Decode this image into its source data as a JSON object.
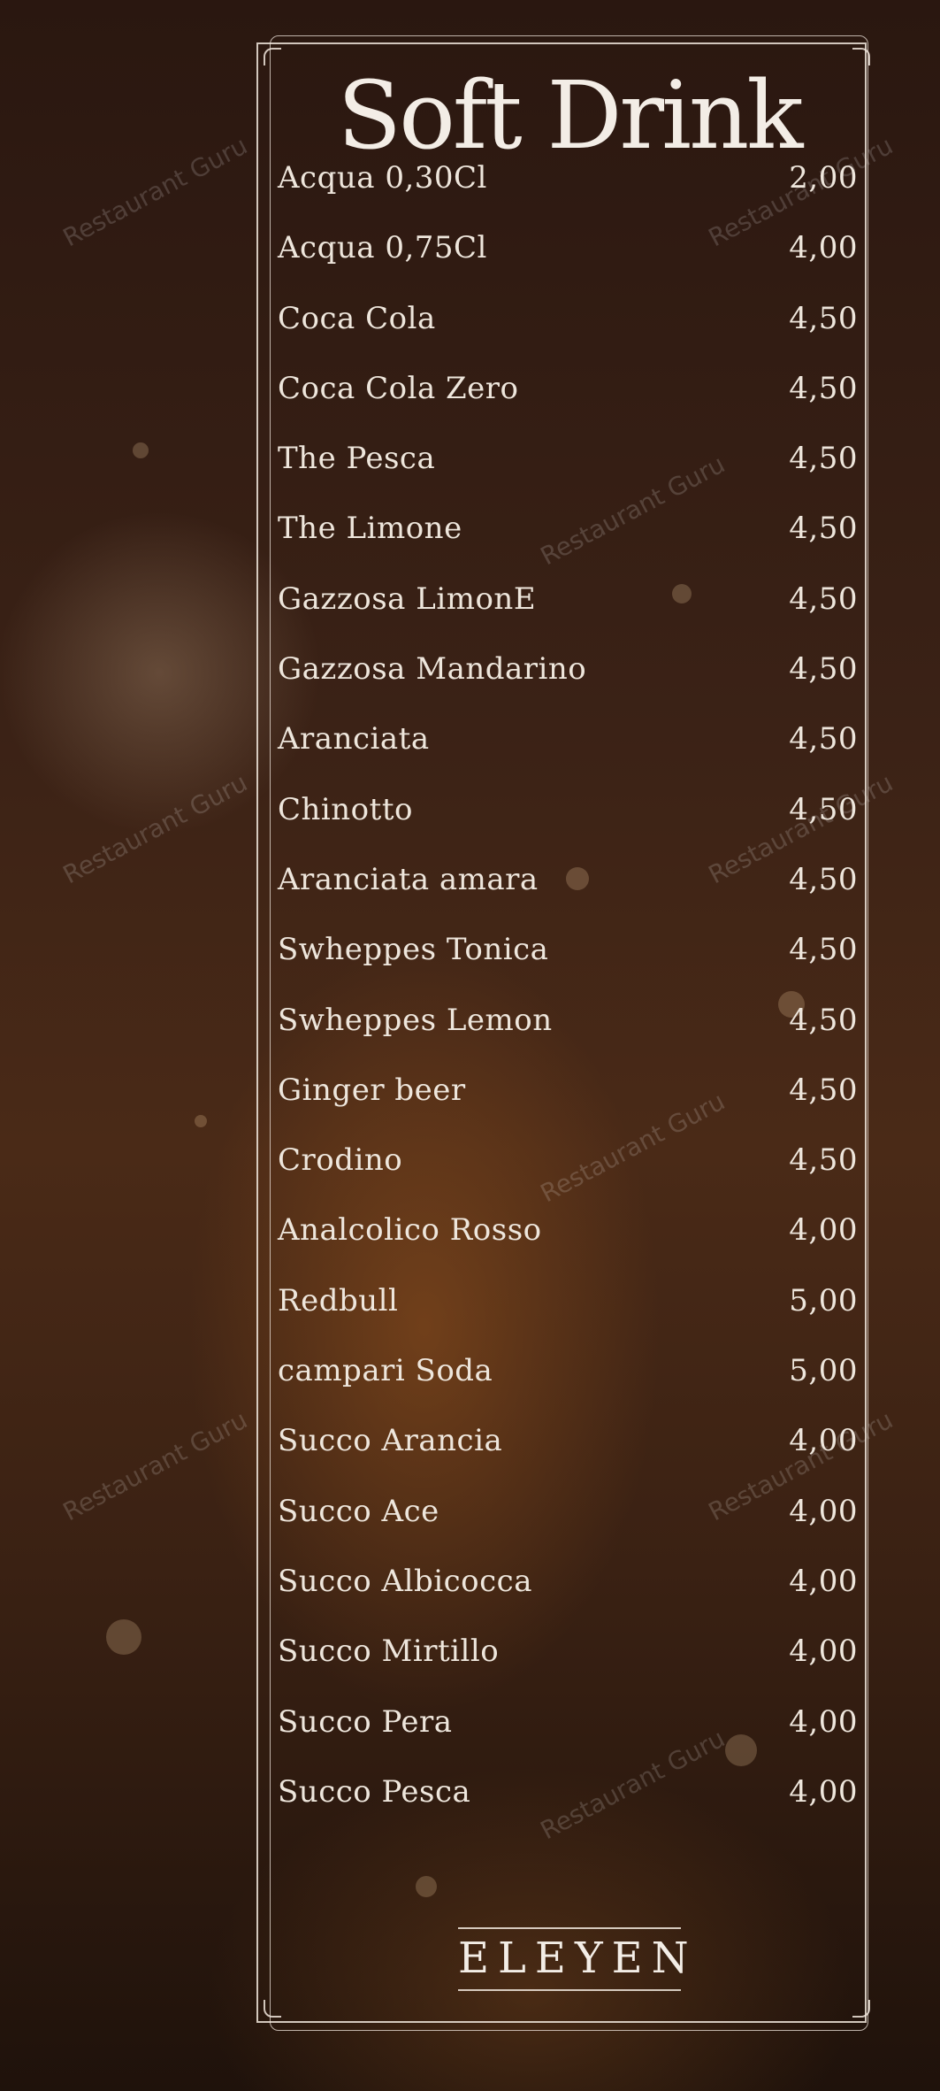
{
  "title": "Soft Drink",
  "items": [
    {
      "name": "Acqua 0,30Cl",
      "price": "2,00"
    },
    {
      "name": "Acqua 0,75Cl",
      "price": "4,00"
    },
    {
      "name": "Coca Cola",
      "price": "4,50"
    },
    {
      "name": "Coca Cola Zero",
      "price": "4,50"
    },
    {
      "name": "The Pesca",
      "price": "4,50"
    },
    {
      "name": "The Limone",
      "price": "4,50"
    },
    {
      "name": "Gazzosa LimonE",
      "price": "4,50"
    },
    {
      "name": "Gazzosa Mandarino",
      "price": "4,50"
    },
    {
      "name": "Aranciata",
      "price": "4,50"
    },
    {
      "name": "Chinotto",
      "price": "4,50"
    },
    {
      "name": "Aranciata amara",
      "price": "4,50"
    },
    {
      "name": "Swheppes Tonica",
      "price": "4,50"
    },
    {
      "name": "Swheppes Lemon",
      "price": "4,50"
    },
    {
      "name": "Ginger beer",
      "price": "4,50"
    },
    {
      "name": "Crodino",
      "price": "4,50"
    },
    {
      "name": "Analcolico Rosso",
      "price": "4,00"
    },
    {
      "name": "Redbull",
      "price": "5,00"
    },
    {
      "name": "campari Soda",
      "price": "5,00"
    },
    {
      "name": "Succo Arancia",
      "price": "4,00"
    },
    {
      "name": "Succo Ace",
      "price": "4,00"
    },
    {
      "name": "Succo Albicocca",
      "price": "4,00"
    },
    {
      "name": "Succo Mirtillo",
      "price": "4,00"
    },
    {
      "name": "Succo Pera",
      "price": "4,00"
    },
    {
      "name": "Succo Pesca",
      "price": "4,00"
    }
  ],
  "logo": "ELEYEN",
  "watermark": "Restaurant Guru"
}
